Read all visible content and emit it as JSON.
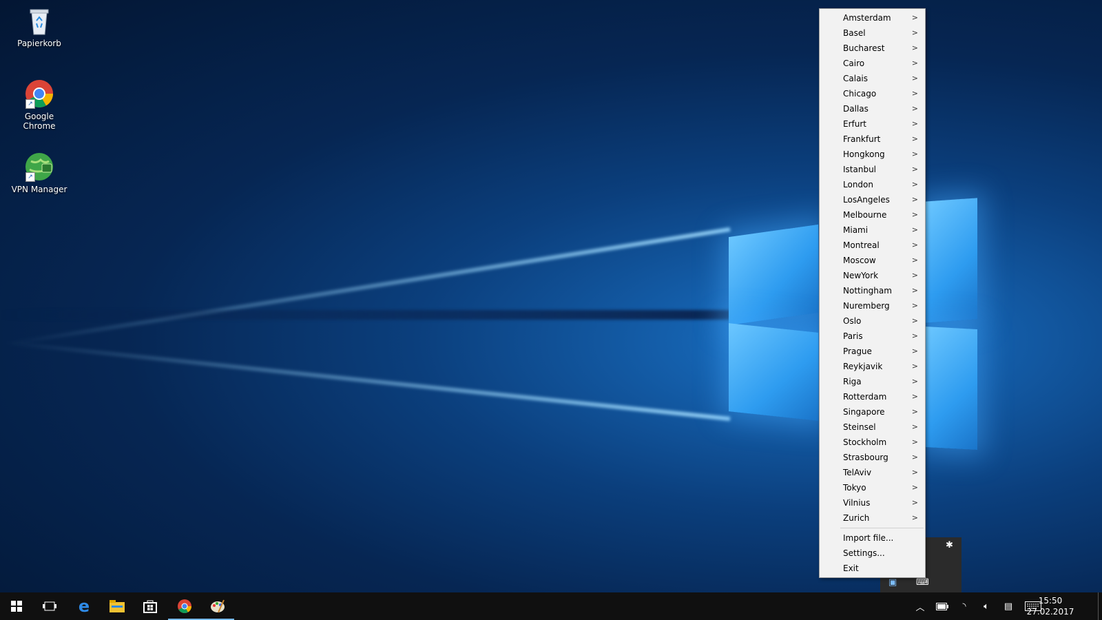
{
  "desktop": {
    "icons": [
      {
        "label": "Papierkorb"
      },
      {
        "label": "Google Chrome"
      },
      {
        "label": "VPN Manager"
      }
    ]
  },
  "menu": {
    "locations": [
      "Amsterdam",
      "Basel",
      "Bucharest",
      "Cairo",
      "Calais",
      "Chicago",
      "Dallas",
      "Erfurt",
      "Frankfurt",
      "Hongkong",
      "Istanbul",
      "London",
      "LosAngeles",
      "Melbourne",
      "Miami",
      "Montreal",
      "Moscow",
      "NewYork",
      "Nottingham",
      "Nuremberg",
      "Oslo",
      "Paris",
      "Prague",
      "Reykjavik",
      "Riga",
      "Rotterdam",
      "Singapore",
      "Steinsel",
      "Stockholm",
      "Strasbourg",
      "TelAviv",
      "Tokyo",
      "Vilnius",
      "Zurich"
    ],
    "submenu_arrow": ">",
    "actions": [
      "Import file...",
      "Settings...",
      "Exit"
    ]
  },
  "taskbar": {
    "clock_time": "15:50",
    "clock_date": "27.02.2017",
    "pinned": [
      {
        "icon": "windows-start-icon"
      },
      {
        "icon": "task-view-icon"
      },
      {
        "icon": "edge-icon"
      },
      {
        "icon": "file-explorer-icon"
      },
      {
        "icon": "store-icon"
      },
      {
        "icon": "chrome-icon"
      },
      {
        "icon": "paint-icon"
      }
    ],
    "tray_icons": [
      "chevron-up-icon",
      "battery-icon",
      "wifi-icon",
      "volume-icon",
      "action-center-icon",
      "keyboard-icon"
    ]
  },
  "colors": {
    "taskbar_bg": "#101010",
    "menu_bg": "#f2f2f2",
    "active_indicator": "#76b9ed"
  }
}
